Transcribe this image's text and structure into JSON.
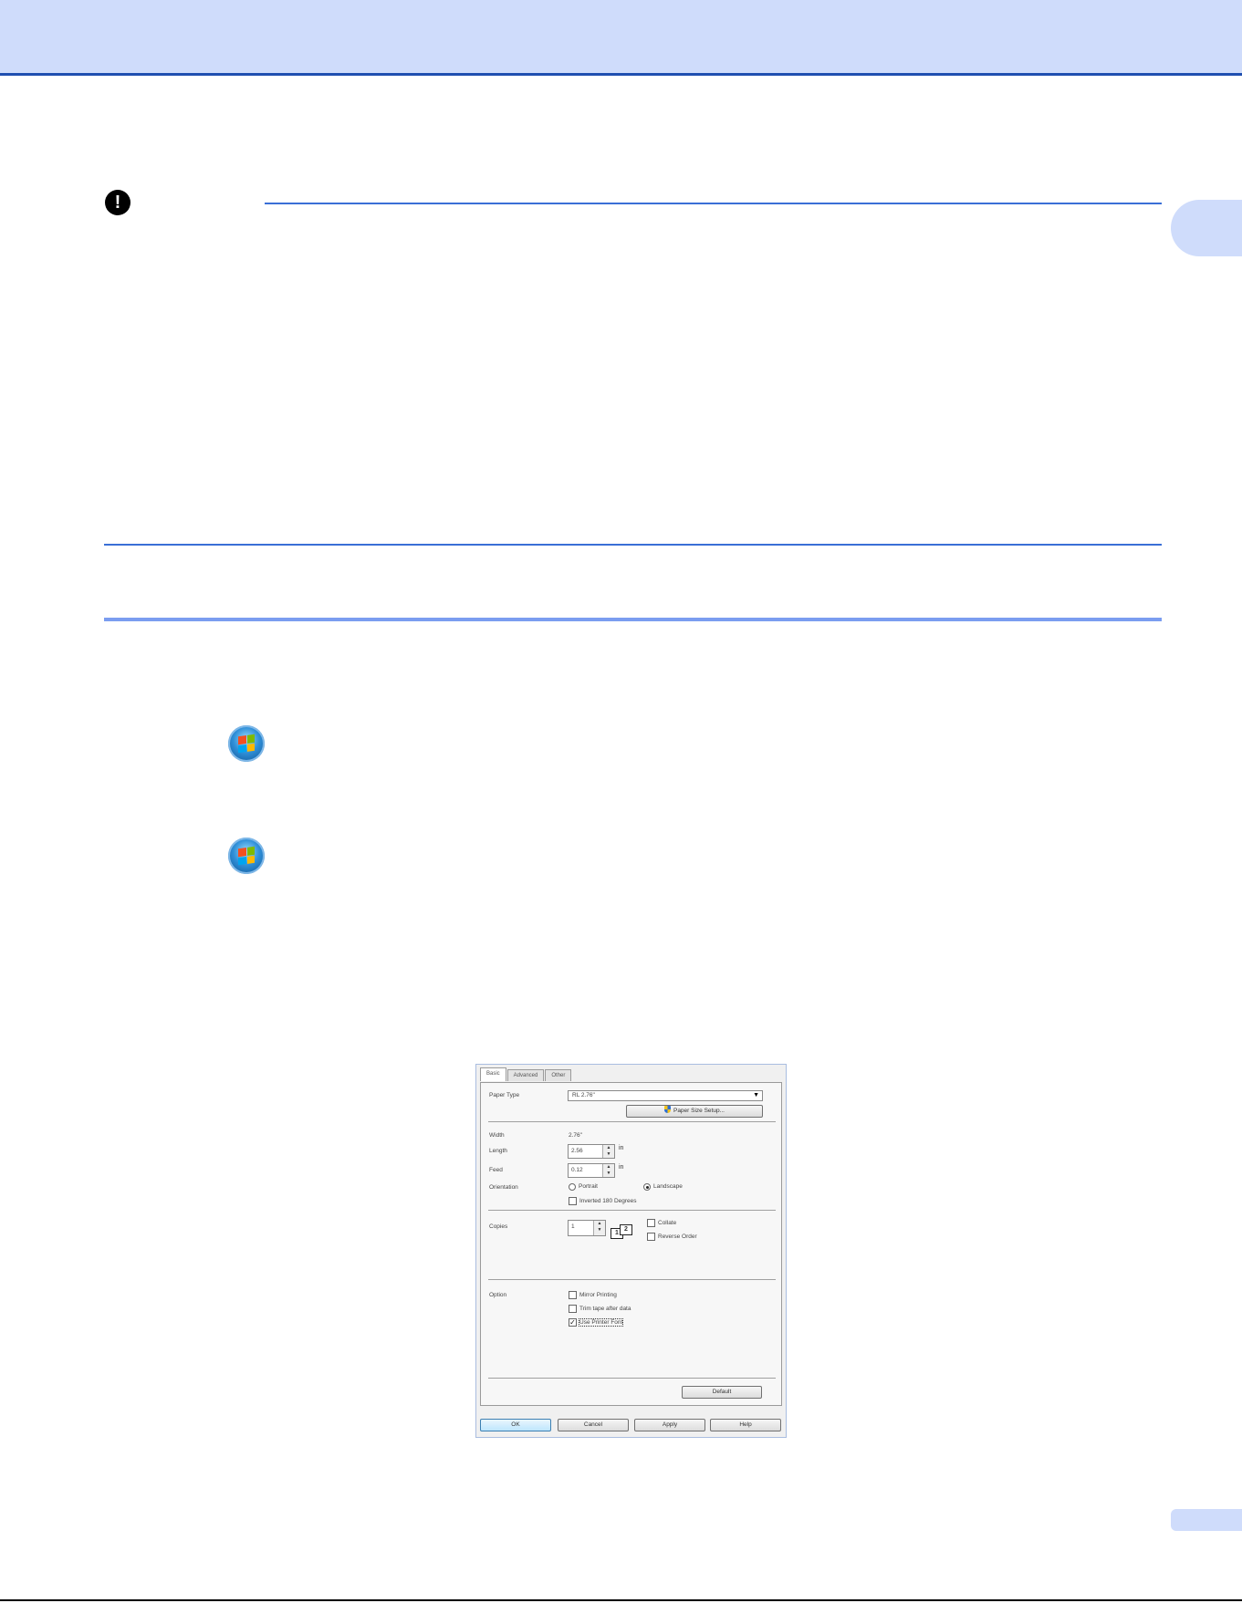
{
  "chapter": {
    "number": ""
  },
  "page": {
    "number": ""
  },
  "dialog": {
    "tabs": [
      "Basic",
      "Advanced",
      "Other"
    ],
    "paper_type": {
      "label": "Paper Type",
      "value": "RL 2.76\""
    },
    "paper_size_setup_button": "Paper Size Setup...",
    "width": {
      "label": "Width",
      "value": "2.76\""
    },
    "length": {
      "label": "Length",
      "value": "2.56",
      "unit": "in"
    },
    "feed": {
      "label": "Feed",
      "value": "0.12",
      "unit": "in"
    },
    "orientation": {
      "label": "Orientation",
      "portrait": "Portrait",
      "landscape": "Landscape"
    },
    "inverted": "Inverted 180 Degrees",
    "copies": {
      "label": "Copies",
      "value": "1",
      "collate": "Collate",
      "reverse_order": "Reverse Order"
    },
    "option": {
      "label": "Option",
      "mirror": "Mirror Printing",
      "trim": "Trim tape after data",
      "use_printer_font": "Use Printer Font"
    },
    "default_button": "Default",
    "ok_button": "OK",
    "cancel_button": "Cancel",
    "apply_button": "Apply",
    "help_button": "Help"
  }
}
